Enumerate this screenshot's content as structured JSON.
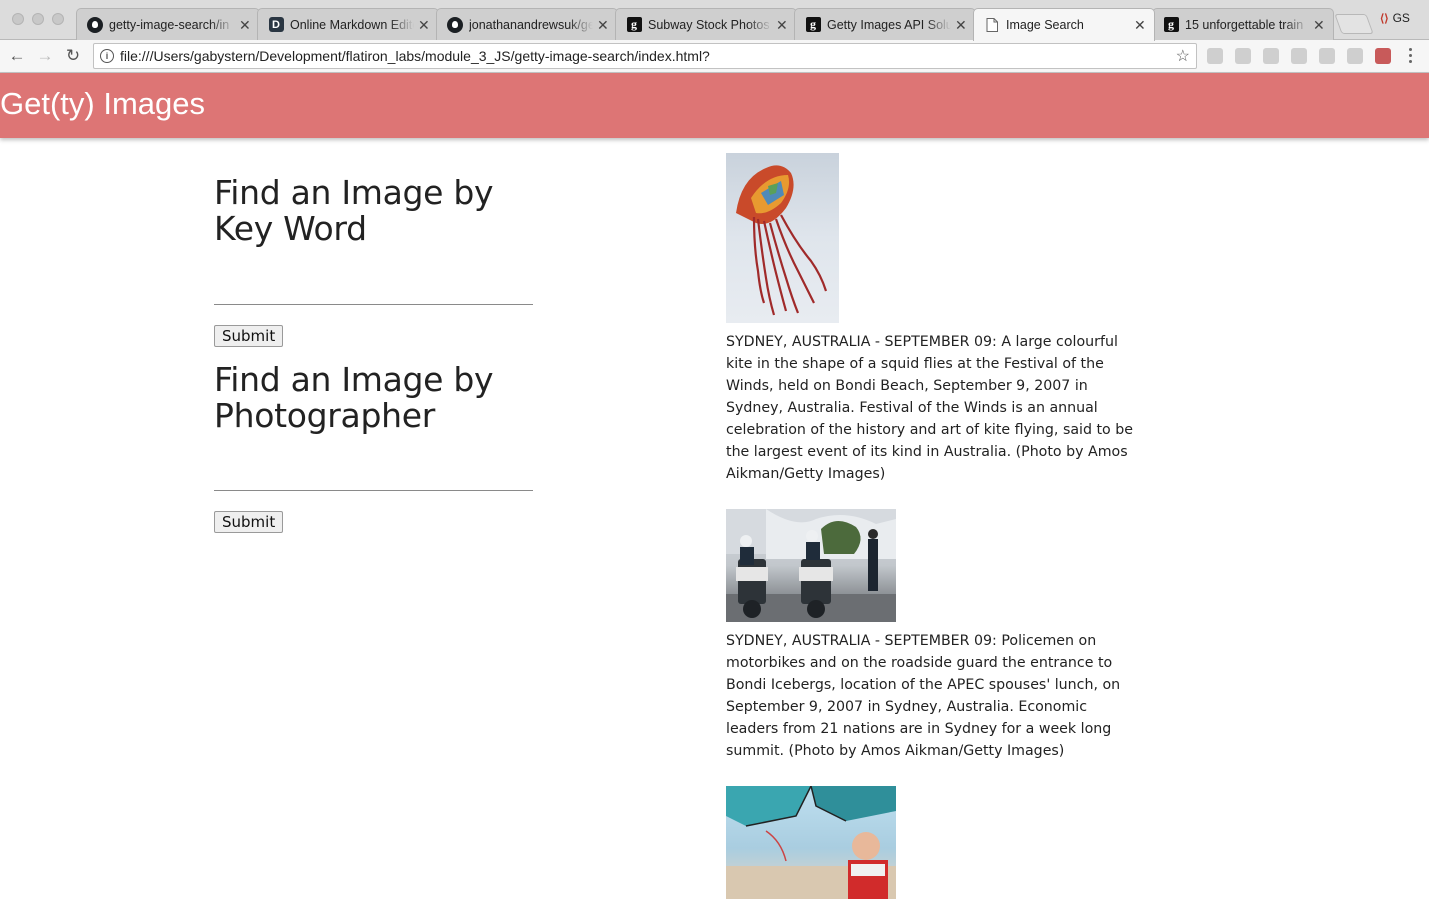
{
  "browser": {
    "tabs": [
      {
        "title": "getty-image-search/in",
        "favicon": "github-icon",
        "active": false
      },
      {
        "title": "Online Markdown Editor",
        "favicon": "dillinger-icon",
        "active": false
      },
      {
        "title": "jonathanandrewsuk/ge",
        "favicon": "github-icon",
        "active": false
      },
      {
        "title": "Subway Stock Photos",
        "favicon": "getty-icon",
        "active": false
      },
      {
        "title": "Getty Images API Solu",
        "favicon": "getty-icon",
        "active": false
      },
      {
        "title": "Image Search",
        "favicon": "page-icon",
        "active": true
      },
      {
        "title": "15 unforgettable train",
        "favicon": "getty-icon",
        "active": false
      }
    ],
    "profile_label": "GS",
    "url": "file:///Users/gabystern/Development/flatiron_labs/module_3_JS/getty-image-search/index.html?"
  },
  "app": {
    "title": "Get(ty) Images",
    "brand_color": "#dd7575"
  },
  "keyword_form": {
    "heading": "Find an Image by Key Word",
    "input_value": "",
    "submit_label": "Submit"
  },
  "photographer_form": {
    "heading": "Find an Image by Photographer",
    "input_value": "",
    "submit_label": "Submit"
  },
  "results": [
    {
      "caption": "SYDNEY, AUSTRALIA - SEPTEMBER 09: A large colourful kite in the shape of a squid flies at the Festival of the Winds, held on Bondi Beach, September 9, 2007 in Sydney, Australia. Festival of the Winds is an annual celebration of the history and art of kite flying, said to be the largest event of its kind in Australia. (Photo by Amos Aikman/Getty Images)"
    },
    {
      "caption": "SYDNEY, AUSTRALIA - SEPTEMBER 09: Policemen on motorbikes and on the roadside guard the entrance to Bondi Icebergs, location of the APEC spouses' lunch, on September 9, 2007 in Sydney, Australia. Economic leaders from 21 nations are in Sydney for a week long summit. (Photo by Amos Aikman/Getty Images)"
    },
    {
      "caption": ""
    }
  ]
}
